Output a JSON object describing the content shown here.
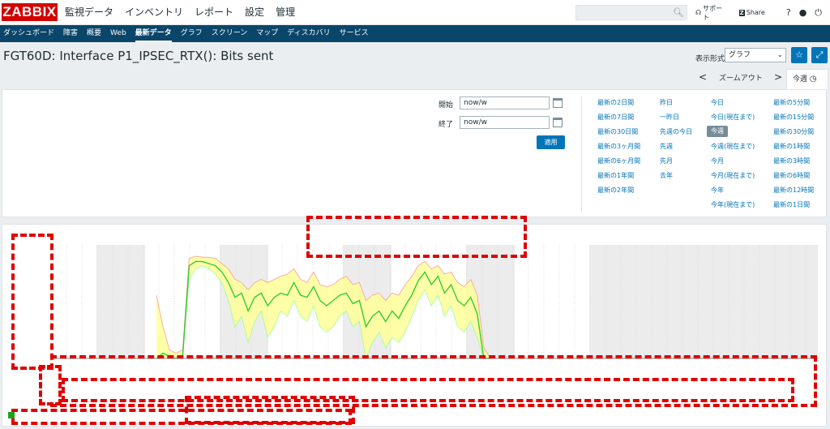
{
  "app": {
    "logo": "ZABBIX"
  },
  "main_menu": [
    "監視データ",
    "インベントリ",
    "レポート",
    "設定",
    "管理"
  ],
  "top_links": {
    "support": "サポート",
    "share": "Share",
    "help": "?",
    "user_icon": "user-icon",
    "logout_icon": "power-icon"
  },
  "sub_menu": [
    "ダッシュボード",
    "障害",
    "概要",
    "Web",
    "最新データ",
    "グラフ",
    "スクリーン",
    "マップ",
    "ディスカバリ",
    "サービス"
  ],
  "sub_menu_active": "最新データ",
  "page": {
    "title": "FGT60D: Interface P1_IPSEC_RTX(): Bits sent",
    "view_label": "表示形式",
    "view_value": "グラフ"
  },
  "timenav": {
    "prev": "<",
    "zoom_out": "ズームアウト",
    "next": ">",
    "active_tab": "今週"
  },
  "filter": {
    "from_label": "開始",
    "from_value": "now/w",
    "to_label": "終了",
    "to_value": "now/w",
    "apply_label": "適用"
  },
  "quick_ranges": {
    "col1": [
      "最新の2日間",
      "最新の7日間",
      "最新の30日間",
      "最新の3ヶ月間",
      "最新の6ヶ月間",
      "最新の1年間",
      "最新の2年間"
    ],
    "col2": [
      "昨日",
      "一昨日",
      "先週の今日",
      "先週",
      "先月",
      "去年"
    ],
    "col3": [
      "今日",
      "今日(現在まで)",
      "今週",
      "今週(現在まで)",
      "今月",
      "今月(現在まで)",
      "今年",
      "今年(現在まで)"
    ],
    "col4": [
      "最新の5分間",
      "最新の15分間",
      "最新の30分間",
      "最新の1時間",
      "最新の3時間",
      "最新の6時間",
      "最新の12時間",
      "最新の1日間"
    ],
    "selected": "今週"
  },
  "chart_data": {
    "type": "area",
    "x": [
      0,
      1,
      2,
      3,
      4,
      5,
      6,
      7,
      8,
      9,
      10,
      11,
      12,
      13,
      14,
      15,
      16,
      17,
      18,
      19,
      20,
      21,
      22,
      23,
      24,
      25,
      26,
      27,
      28,
      29,
      30,
      31,
      32,
      33,
      34,
      35,
      36,
      37,
      38,
      39,
      40,
      41,
      42,
      43,
      44,
      45,
      46,
      47,
      48,
      49,
      50,
      51,
      52,
      53,
      54,
      55,
      56,
      57,
      58,
      59,
      60
    ],
    "series": [
      {
        "role": "avg",
        "values": [
          0,
          0.05,
          0.02,
          0,
          0.02,
          0.88,
          0.92,
          0.92,
          0.9,
          0.88,
          0.82,
          0.72,
          0.58,
          0.62,
          0.45,
          0.58,
          0.62,
          0.5,
          0.58,
          0.62,
          0.6,
          0.72,
          0.6,
          0.58,
          0.68,
          0.55,
          0.5,
          0.55,
          0.6,
          0.62,
          0.52,
          0.55,
          0.3,
          0.4,
          0.45,
          0.35,
          0.45,
          0.38,
          0.5,
          0.6,
          0.74,
          0.82,
          0.7,
          0.78,
          0.62,
          0.7,
          0.55,
          0.5,
          0.58,
          0.42,
          0.0,
          0.0
        ]
      },
      {
        "role": "max",
        "values": [
          0.6,
          0.3,
          0.08,
          0.05,
          0.08,
          0.95,
          0.97,
          0.96,
          0.96,
          0.95,
          0.9,
          0.85,
          0.75,
          0.72,
          0.65,
          0.72,
          0.75,
          0.72,
          0.75,
          0.78,
          0.8,
          0.85,
          0.75,
          0.72,
          0.82,
          0.7,
          0.68,
          0.7,
          0.75,
          0.78,
          0.7,
          0.72,
          0.55,
          0.6,
          0.62,
          0.55,
          0.62,
          0.6,
          0.7,
          0.78,
          0.88,
          0.92,
          0.85,
          0.88,
          0.8,
          0.82,
          0.72,
          0.68,
          0.75,
          0.6,
          0.1,
          0.0
        ]
      },
      {
        "role": "min",
        "values": [
          0,
          0,
          0,
          0,
          0,
          0.75,
          0.85,
          0.88,
          0.85,
          0.8,
          0.72,
          0.55,
          0.3,
          0.4,
          0.15,
          0.35,
          0.45,
          0.2,
          0.3,
          0.45,
          0.4,
          0.55,
          0.4,
          0.35,
          0.5,
          0.3,
          0.25,
          0.3,
          0.4,
          0.45,
          0.3,
          0.35,
          0.0,
          0.15,
          0.25,
          0.1,
          0.2,
          0.15,
          0.25,
          0.4,
          0.55,
          0.65,
          0.5,
          0.6,
          0.4,
          0.5,
          0.3,
          0.25,
          0.35,
          0.2,
          0.0,
          0.0
        ]
      }
    ],
    "colors": {
      "avg": "#33cc33",
      "band": "#ffff99",
      "max": "#ff9999",
      "min": "#99ff99"
    }
  }
}
